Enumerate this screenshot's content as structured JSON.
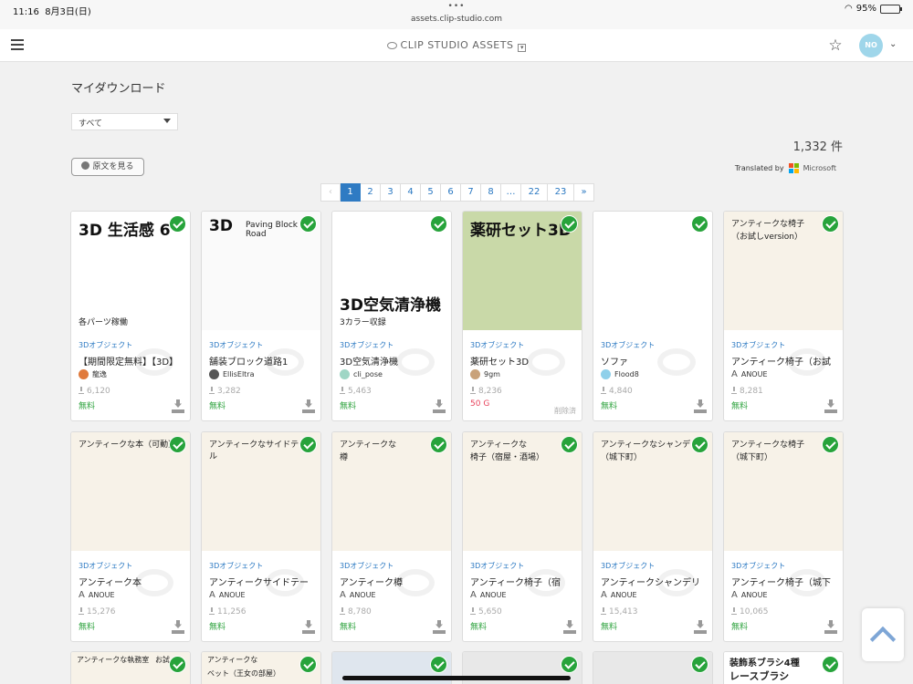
{
  "status": {
    "time": "11:16",
    "date": "8月3日(日)",
    "url": "assets.clip-studio.com",
    "battery": "95%",
    "battery_level": 0.95
  },
  "header": {
    "logo": "CLIP STUDIO ASSETS",
    "avatar_text": "NO"
  },
  "page": {
    "title": "マイダウンロード",
    "filter_value": "すべて",
    "count": "1,332 件",
    "original_button": "原文を見る",
    "translated_by": "Translated by",
    "translator": "Microsoft",
    "ms_colors": [
      "#f25022",
      "#7fba00",
      "#00a4ef",
      "#ffb900"
    ]
  },
  "pager": {
    "prev": "‹",
    "pages": [
      "1",
      "2",
      "3",
      "4",
      "5",
      "6",
      "7",
      "8",
      "…",
      "22",
      "23"
    ],
    "next": "»",
    "current": "1"
  },
  "cards": [
    {
      "category": "3Dオブジェクト",
      "title": "【期間限定無料】【3D】",
      "author": "龍逸",
      "downloads": "6,120",
      "price": "無料",
      "thumb_top": "3D 生活感 6",
      "thumb_bottom": "各パーツ稼働",
      "avatar_color": "#e07a3c"
    },
    {
      "category": "3Dオブジェクト",
      "title": "舗装ブロック道路1",
      "author": "EllisEltra",
      "downloads": "3,282",
      "price": "無料",
      "thumb_top": "3D",
      "thumb_bottom": "Paving Block Road",
      "avatar_color": "#555555"
    },
    {
      "category": "3Dオブジェクト",
      "title": "3D空気清浄機",
      "author": "cli_pose",
      "downloads": "5,463",
      "price": "無料",
      "thumb_top": "3D空気清浄機",
      "thumb_bottom": "3カラー収録",
      "avatar_color": "#9fd6c5"
    },
    {
      "category": "3Dオブジェクト",
      "title": "薬研セット3D",
      "author": "9gm",
      "downloads": "8,236",
      "price": "50 G",
      "deleted": "削除済",
      "thumb_top": "薬研セット3D",
      "avatar_color": "#c9a27a"
    },
    {
      "category": "3Dオブジェクト",
      "title": "ソファ",
      "author": "Flood8",
      "downloads": "4,840",
      "price": "無料",
      "avatar_color": "#8fd0ea"
    },
    {
      "category": "3Dオブジェクト",
      "title": "アンティーク椅子（お試",
      "author": "ANOUE",
      "downloads": "8,281",
      "price": "無料",
      "thumb_top": "アンティークな椅子",
      "thumb_bottom": "（お試しversion）"
    },
    {
      "category": "3Dオブジェクト",
      "title": "アンティーク本",
      "author": "ANOUE",
      "downloads": "15,276",
      "price": "無料",
      "thumb_top": "アンティークな本（可動）"
    },
    {
      "category": "3Dオブジェクト",
      "title": "アンティークサイドテー",
      "author": "ANOUE",
      "downloads": "11,256",
      "price": "無料",
      "thumb_top": "アンティークなサイドテーブル"
    },
    {
      "category": "3Dオブジェクト",
      "title": "アンティーク樽",
      "author": "ANOUE",
      "downloads": "8,780",
      "price": "無料",
      "thumb_top": "アンティークな",
      "thumb_bottom": "樽"
    },
    {
      "category": "3Dオブジェクト",
      "title": "アンティーク椅子（宿",
      "author": "ANOUE",
      "downloads": "5,650",
      "price": "無料",
      "thumb_top": "アンティークな",
      "thumb_bottom": "椅子（宿屋・酒場）"
    },
    {
      "category": "3Dオブジェクト",
      "title": "アンティークシャンデリ",
      "author": "ANOUE",
      "downloads": "15,413",
      "price": "無料",
      "thumb_top": "アンティークなシャンデリア",
      "thumb_bottom": "（城下町）"
    },
    {
      "category": "3Dオブジェクト",
      "title": "アンティーク椅子（城下",
      "author": "ANOUE",
      "downloads": "10,065",
      "price": "無料",
      "thumb_top": "アンティークな椅子",
      "thumb_bottom": "（城下町）"
    }
  ],
  "row3": [
    {
      "thumb_top": "アンティークな執務室",
      "thumb_bottom": "お試"
    },
    {
      "thumb_top": "アンティークな",
      "thumb_bottom": "ベット（王女の部屋）"
    },
    {
      "thumb_top": ""
    },
    {
      "thumb_top": ""
    },
    {
      "thumb_top": ""
    },
    {
      "thumb_top": "装飾系ブラシ4種",
      "thumb_bottom": "レースブラシ"
    }
  ]
}
